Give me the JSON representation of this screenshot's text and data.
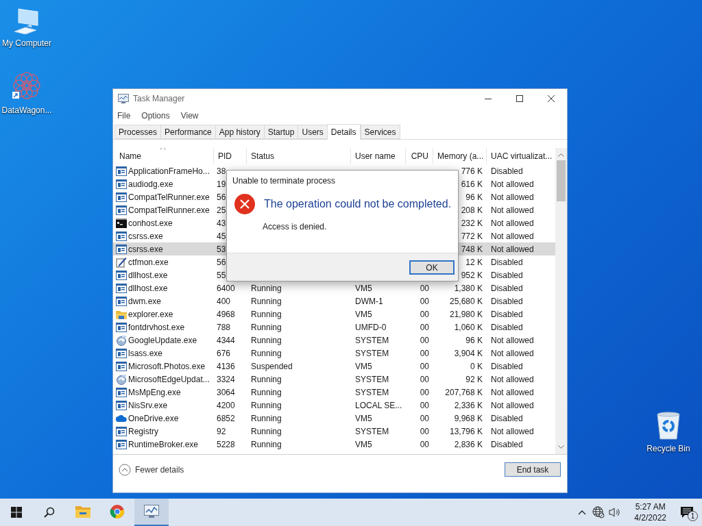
{
  "desktop_icons": [
    {
      "kind": "computer",
      "label": "My Computer"
    },
    {
      "kind": "app",
      "label": "DataWagon..."
    },
    {
      "kind": "recycle",
      "label": "Recycle Bin"
    }
  ],
  "window": {
    "title": "Task Manager",
    "menu": [
      "File",
      "Options",
      "View"
    ],
    "tabs": [
      {
        "label": "Processes",
        "selected": false
      },
      {
        "label": "Performance",
        "selected": false
      },
      {
        "label": "App history",
        "selected": false
      },
      {
        "label": "Startup",
        "selected": false
      },
      {
        "label": "Users",
        "selected": false
      },
      {
        "label": "Details",
        "selected": true
      },
      {
        "label": "Services",
        "selected": false
      }
    ],
    "columns": [
      "Name",
      "PID",
      "Status",
      "User name",
      "CPU",
      "Memory (a...",
      "UAC virtualizat..."
    ],
    "rows": [
      {
        "kind": "app",
        "name": "ApplicationFrameHo...",
        "pid": "38",
        "memory": "776 K",
        "uac": "Disabled",
        "selected": false
      },
      {
        "kind": "app",
        "name": "audiodg.exe",
        "pid": "19",
        "memory": "616 K",
        "uac": "Not allowed",
        "selected": false
      },
      {
        "kind": "app",
        "name": "CompatTelRunner.exe",
        "pid": "56",
        "memory": "96 K",
        "uac": "Not allowed",
        "selected": false
      },
      {
        "kind": "app",
        "name": "CompatTelRunner.exe",
        "pid": "25",
        "memory": "208 K",
        "uac": "Not allowed",
        "selected": false
      },
      {
        "kind": "console",
        "name": "conhost.exe",
        "pid": "43",
        "memory": "232 K",
        "uac": "Not allowed",
        "selected": false
      },
      {
        "kind": "app",
        "name": "csrss.exe",
        "pid": "45",
        "memory": "772 K",
        "uac": "Not allowed",
        "selected": false
      },
      {
        "kind": "app",
        "name": "csrss.exe",
        "pid": "53",
        "memory": "748 K",
        "uac": "Not allowed",
        "selected": true
      },
      {
        "kind": "pen",
        "name": "ctfmon.exe",
        "pid": "56",
        "memory": "12 K",
        "uac": "Disabled",
        "selected": false
      },
      {
        "kind": "app",
        "name": "dllhost.exe",
        "pid": "55",
        "memory": "952 K",
        "uac": "Disabled",
        "selected": false
      },
      {
        "kind": "app",
        "name": "dllhost.exe",
        "pid": "6400",
        "status": "Running",
        "user": "VM5",
        "cpu": "00",
        "memory": "1,380 K",
        "uac": "Disabled",
        "selected": false
      },
      {
        "kind": "app",
        "name": "dwm.exe",
        "pid": "400",
        "status": "Running",
        "user": "DWM-1",
        "cpu": "00",
        "memory": "25,680 K",
        "uac": "Disabled",
        "selected": false
      },
      {
        "kind": "folder",
        "name": "explorer.exe",
        "pid": "4968",
        "status": "Running",
        "user": "VM5",
        "cpu": "00",
        "memory": "21,980 K",
        "uac": "Disabled",
        "selected": false
      },
      {
        "kind": "app",
        "name": "fontdrvhost.exe",
        "pid": "788",
        "status": "Running",
        "user": "UMFD-0",
        "cpu": "00",
        "memory": "1,060 K",
        "uac": "Disabled",
        "selected": false
      },
      {
        "kind": "update",
        "name": "GoogleUpdate.exe",
        "pid": "4344",
        "status": "Running",
        "user": "SYSTEM",
        "cpu": "00",
        "memory": "96 K",
        "uac": "Not allowed",
        "selected": false
      },
      {
        "kind": "app",
        "name": "lsass.exe",
        "pid": "676",
        "status": "Running",
        "user": "SYSTEM",
        "cpu": "00",
        "memory": "3,904 K",
        "uac": "Not allowed",
        "selected": false
      },
      {
        "kind": "app",
        "name": "Microsoft.Photos.exe",
        "pid": "4136",
        "status": "Suspended",
        "user": "VM5",
        "cpu": "00",
        "memory": "0 K",
        "uac": "Disabled",
        "selected": false
      },
      {
        "kind": "update",
        "name": "MicrosoftEdgeUpdat...",
        "pid": "3324",
        "status": "Running",
        "user": "SYSTEM",
        "cpu": "00",
        "memory": "92 K",
        "uac": "Not allowed",
        "selected": false
      },
      {
        "kind": "app",
        "name": "MsMpEng.exe",
        "pid": "3064",
        "status": "Running",
        "user": "SYSTEM",
        "cpu": "00",
        "memory": "207,768 K",
        "uac": "Not allowed",
        "selected": false
      },
      {
        "kind": "app",
        "name": "NisSrv.exe",
        "pid": "4200",
        "status": "Running",
        "user": "LOCAL SE...",
        "cpu": "00",
        "memory": "2,336 K",
        "uac": "Not allowed",
        "selected": false
      },
      {
        "kind": "cloud",
        "name": "OneDrive.exe",
        "pid": "6852",
        "status": "Running",
        "user": "VM5",
        "cpu": "00",
        "memory": "9,968 K",
        "uac": "Disabled",
        "selected": false
      },
      {
        "kind": "app",
        "name": "Registry",
        "pid": "92",
        "status": "Running",
        "user": "SYSTEM",
        "cpu": "00",
        "memory": "13,796 K",
        "uac": "Not allowed",
        "selected": false
      },
      {
        "kind": "app",
        "name": "RuntimeBroker.exe",
        "pid": "5228",
        "status": "Running",
        "user": "VM5",
        "cpu": "00",
        "memory": "2,836 K",
        "uac": "Disabled",
        "selected": false
      }
    ],
    "fewer_details": "Fewer details",
    "end_task": "End task"
  },
  "dialog": {
    "title": "Unable to terminate process",
    "heading": "The operation could not be completed.",
    "message": "Access is denied.",
    "button": "OK"
  },
  "taskbar": {
    "apps": [
      {
        "kind": "folder",
        "active": false
      },
      {
        "kind": "browser",
        "active": false
      },
      {
        "kind": "taskmanager",
        "active": true
      }
    ],
    "time": "5:27 AM",
    "date": "4/2/2022",
    "notification_count": "1"
  }
}
